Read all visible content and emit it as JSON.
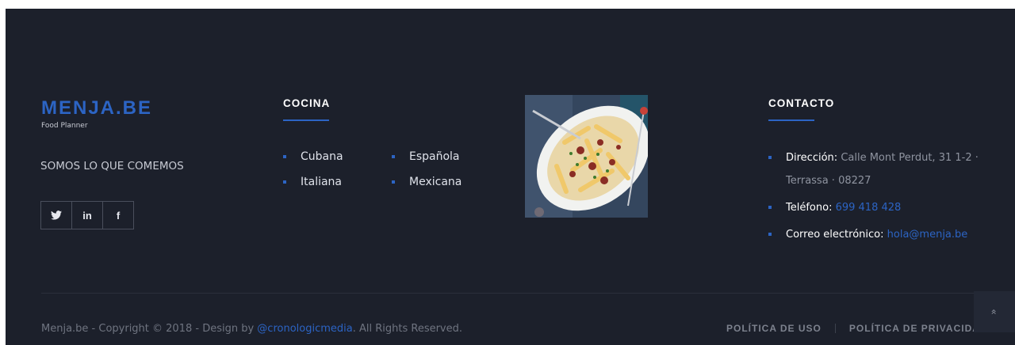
{
  "brand": {
    "logo": "MENJA.BE",
    "subtitle": "Food Planner",
    "tagline": "SOMOS LO QUE COMEMOS"
  },
  "social": [
    {
      "icon": "twitter-icon",
      "label": "🐦"
    },
    {
      "icon": "linkedin-icon",
      "label": "in"
    },
    {
      "icon": "facebook-icon",
      "label": "f"
    }
  ],
  "cocina": {
    "title": "COCINA",
    "items": [
      "Cubana",
      "Española",
      "Italiana",
      "Mexicana"
    ]
  },
  "contacto": {
    "title": "CONTACTO",
    "address_label": "Dirección:",
    "address_value": "Calle Mont Perdut, 31 1-2 · Terrassa · 08227",
    "phone_label": "Teléfono:",
    "phone_value": "699 418 428",
    "email_label": "Correo electrónico:",
    "email_value": "hola@menja.be"
  },
  "footer": {
    "copyright_prefix": "Menja.be - Copyright © 2018 - Design by ",
    "copyright_link": "@cronologicmedia",
    "copyright_suffix": ". All Rights Reserved.",
    "legal_use": "POLÍTICA DE USO",
    "legal_privacy": "POLÍTICA DE PRIVACIDAD",
    "back_to_top": "«"
  },
  "colors": {
    "background": "#1c202b",
    "accent": "#2c64c4",
    "text": "#dfe2ea",
    "muted": "#6f7480"
  }
}
